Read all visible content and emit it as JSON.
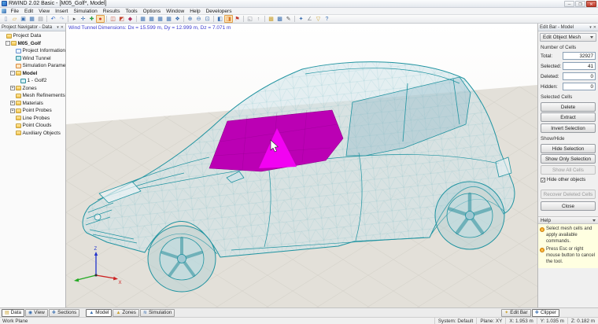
{
  "window": {
    "title": "RWIND 2.02 Basic - [M05_Golf*, Model]",
    "controls": [
      {
        "name": "minimize-button",
        "glyph": "─"
      },
      {
        "name": "maximize-button",
        "glyph": "❐"
      },
      {
        "name": "close-button",
        "glyph": "✕"
      }
    ]
  },
  "menu": {
    "items": [
      "File",
      "Edit",
      "View",
      "Insert",
      "Simulation",
      "Results",
      "Tools",
      "Options",
      "Window",
      "Help",
      "Developers"
    ]
  },
  "toolbar": {
    "icons": [
      {
        "name": "new-file",
        "glyph": "▯",
        "color": "#7a8fae"
      },
      {
        "name": "open-file",
        "glyph": "▱",
        "color": "#d9a32a"
      },
      {
        "name": "save",
        "glyph": "▣",
        "color": "#3a6fb0"
      },
      {
        "name": "save-as",
        "glyph": "▦",
        "color": "#3a6fb0"
      },
      {
        "name": "print",
        "glyph": "▤",
        "color": "#8a8f96"
      },
      {
        "sep": true
      },
      {
        "name": "undo",
        "glyph": "↶",
        "color": "#2a64c8"
      },
      {
        "name": "redo",
        "glyph": "↷",
        "color": "#9ab0d8"
      },
      {
        "sep": true
      },
      {
        "name": "select-arrow",
        "glyph": "▸",
        "color": "#555555"
      },
      {
        "name": "move-tool",
        "glyph": "✛",
        "color": "#3a6fb0"
      },
      {
        "name": "add-object",
        "glyph": "✚",
        "color": "#2f9e44"
      },
      {
        "name": "select-cells-tool",
        "glyph": "●",
        "color": "#d23b2f",
        "active": true
      },
      {
        "sep": true
      },
      {
        "name": "wind-tunnel-tool",
        "glyph": "◫",
        "color": "#c2452f"
      },
      {
        "name": "simulation-settings",
        "glyph": "◩",
        "color": "#c2452f"
      },
      {
        "name": "mesh-tool",
        "glyph": "◆",
        "color": "#b03060"
      },
      {
        "sep": true
      },
      {
        "name": "table-results",
        "glyph": "▦",
        "color": "#3a6fb0"
      },
      {
        "name": "table-zones",
        "glyph": "▦",
        "color": "#3a6fb0"
      },
      {
        "name": "table-probes",
        "glyph": "▦",
        "color": "#3a6fb0"
      },
      {
        "name": "table-graphs",
        "glyph": "▦",
        "color": "#3a6fb0"
      },
      {
        "name": "window-layout",
        "glyph": "❖",
        "color": "#3a6fb0"
      },
      {
        "sep": true
      },
      {
        "name": "zoom-in",
        "glyph": "⊕",
        "color": "#3a6fb0"
      },
      {
        "name": "zoom-out",
        "glyph": "⊖",
        "color": "#3a6fb0"
      },
      {
        "name": "zoom-window",
        "glyph": "⊡",
        "color": "#3a6fb0"
      },
      {
        "sep": true
      },
      {
        "name": "view-options",
        "glyph": "◧",
        "color": "#3a6fb0"
      },
      {
        "name": "edit-mesh-mode",
        "glyph": "◨",
        "color": "#e07b27",
        "active": true
      },
      {
        "name": "flag-tool",
        "glyph": "⚑",
        "color": "#c23b2f"
      },
      {
        "sep": true
      },
      {
        "name": "copy-view",
        "glyph": "◱",
        "color": "#8a8f96"
      },
      {
        "name": "export-view",
        "glyph": "↑",
        "color": "#8a8f96"
      },
      {
        "sep": true
      },
      {
        "name": "palette-a",
        "glyph": "▩",
        "color": "#caa12f"
      },
      {
        "name": "palette-b",
        "glyph": "▩",
        "color": "#3a6fb0"
      },
      {
        "name": "annotate",
        "glyph": "✎",
        "color": "#555555"
      },
      {
        "sep": true
      },
      {
        "name": "tools-misc",
        "glyph": "✦",
        "color": "#3a6fb0"
      },
      {
        "name": "measure",
        "glyph": "∠",
        "color": "#8a8f96"
      },
      {
        "name": "filter",
        "glyph": "▽",
        "color": "#caa12f"
      },
      {
        "name": "help-pointer",
        "glyph": "?",
        "color": "#3a6fb0"
      }
    ]
  },
  "navigator": {
    "title": "Project Navigator - Data",
    "header_controls": [
      {
        "name": "panel-menu",
        "glyph": "▾"
      },
      {
        "name": "panel-close",
        "glyph": "✕"
      }
    ],
    "tree": [
      {
        "label": "Project Data",
        "level": 0,
        "icon": "folder"
      },
      {
        "label": "M05_Golf",
        "level": 1,
        "icon": "folder",
        "bold": true,
        "expander": "-"
      },
      {
        "label": "Project Information",
        "level": 2,
        "icon": "info"
      },
      {
        "label": "Wind Tunnel",
        "level": 2,
        "icon": "wind"
      },
      {
        "label": "Simulation Parameters",
        "level": 2,
        "icon": "params"
      },
      {
        "label": "Model",
        "level": 2,
        "icon": "folder",
        "bold": true,
        "expander": "-"
      },
      {
        "label": "1 - Golf2",
        "level": 3,
        "icon": "model"
      },
      {
        "label": "Zones",
        "level": 2,
        "icon": "folder",
        "expander": "+"
      },
      {
        "label": "Mesh Refinements",
        "level": 2,
        "icon": "folder"
      },
      {
        "label": "Materials",
        "level": 2,
        "icon": "folder",
        "expander": "+"
      },
      {
        "label": "Point Probes",
        "level": 2,
        "icon": "folder",
        "expander": "+"
      },
      {
        "label": "Line Probes",
        "level": 2,
        "icon": "folder"
      },
      {
        "label": "Point Clouds",
        "level": 2,
        "icon": "folder"
      },
      {
        "label": "Auxiliary Objects",
        "level": 2,
        "icon": "folder"
      }
    ],
    "tabs": [
      {
        "label": "Data",
        "icon": "▤",
        "color": "#caa12f",
        "active": true
      },
      {
        "label": "View",
        "icon": "◉",
        "color": "#3a6fb0",
        "active": false
      },
      {
        "label": "Sections",
        "icon": "❖",
        "color": "#3a6fb0",
        "active": false
      }
    ]
  },
  "viewport": {
    "info_text": "Wind Tunnel Dimensions: Dx = 15.599 m, Dy = 12.999 m, Dz = 7.071 m",
    "axis_labels": {
      "z": "Z",
      "x": "X"
    },
    "tabs": [
      {
        "label": "Model",
        "icon": "▲",
        "color": "#3a6fb0",
        "active": true
      },
      {
        "label": "Zones",
        "icon": "▲",
        "color": "#caa12f",
        "active": false
      },
      {
        "label": "Simulation",
        "icon": "≋",
        "color": "#3a6fb0",
        "active": false
      }
    ]
  },
  "editbar": {
    "title": "Edit Bar - Model",
    "header_controls": [
      {
        "name": "panel-menu",
        "glyph": "▾"
      },
      {
        "name": "panel-close",
        "glyph": "✕"
      }
    ],
    "mode_dropdown": "Edit Object Mesh",
    "number_of_cells": {
      "label": "Number of Cells",
      "rows": [
        {
          "name": "total",
          "label": "Total:",
          "value": "32927"
        },
        {
          "name": "selected",
          "label": "Selected:",
          "value": "41"
        },
        {
          "name": "deleted",
          "label": "Deleted:",
          "value": "0"
        },
        {
          "name": "hidden",
          "label": "Hidden:",
          "value": "0"
        }
      ]
    },
    "selected_cells": {
      "label": "Selected Cells",
      "buttons": [
        "Delete",
        "Extract",
        "Invert Selection"
      ]
    },
    "show_hide": {
      "label": "Show/Hide",
      "buttons": [
        {
          "label": "Hide Selection",
          "enabled": true
        },
        {
          "label": "Show Only Selection",
          "enabled": true
        },
        {
          "label": "Show All Cells",
          "enabled": false
        }
      ],
      "checkbox": {
        "label": "Hide other objects",
        "checked": true
      }
    },
    "recover_button": {
      "label": "Recover Deleted Cells",
      "enabled": false
    },
    "close_button": "Close",
    "help": {
      "title": "Help",
      "notes": [
        "Select mesh cells and apply available commands.",
        "Press Esc or right mouse button to cancel the tool."
      ]
    },
    "tabs": [
      {
        "label": "Edit Bar",
        "icon": "✦",
        "color": "#caa12f",
        "active": false
      },
      {
        "label": "Clipper",
        "icon": "❖",
        "color": "#3a6fb0",
        "active": true
      }
    ]
  },
  "statusbar": {
    "left": "Work Plane",
    "items": [
      "System: Default",
      "Plane: XY",
      "X: 1.953 m",
      "Y: 1.035 m",
      "Z: 0.182 m"
    ]
  },
  "colors": {
    "wireframe": "#1f93a0",
    "selection": "#bb00b4",
    "selection_highlight": "#f202f2",
    "ground": "#e3e0d9",
    "info_text": "#3a3ad0"
  }
}
